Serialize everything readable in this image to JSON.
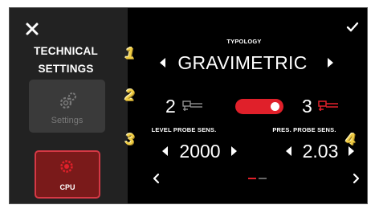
{
  "sidebar": {
    "title_line1": "TECHNICAL",
    "title_line2": "SETTINGS",
    "settings_tile": {
      "label": "Settings",
      "icon": "gears-icon"
    },
    "cpu_tile": {
      "label": "CPU",
      "icon": "cpu-chip-icon"
    }
  },
  "badges": {
    "b1": "1",
    "b2": "2",
    "b3": "3",
    "b4": "4"
  },
  "typology": {
    "label": "TYPOLOGY",
    "value": "GRAVIMETRIC"
  },
  "probes": {
    "left_count": "2",
    "right_count": "3",
    "toggle_on": true
  },
  "level_probe": {
    "label": "LEVEL PROBE SENS.",
    "value": "2000"
  },
  "pres_probe": {
    "label": "PRES. PROBE SENS.",
    "value": "2.03"
  },
  "colors": {
    "accent": "#e0202a",
    "badge": "#f0cd45",
    "sidebar_bg": "#222222",
    "cpu_tile_bg": "#7a1a1a"
  }
}
